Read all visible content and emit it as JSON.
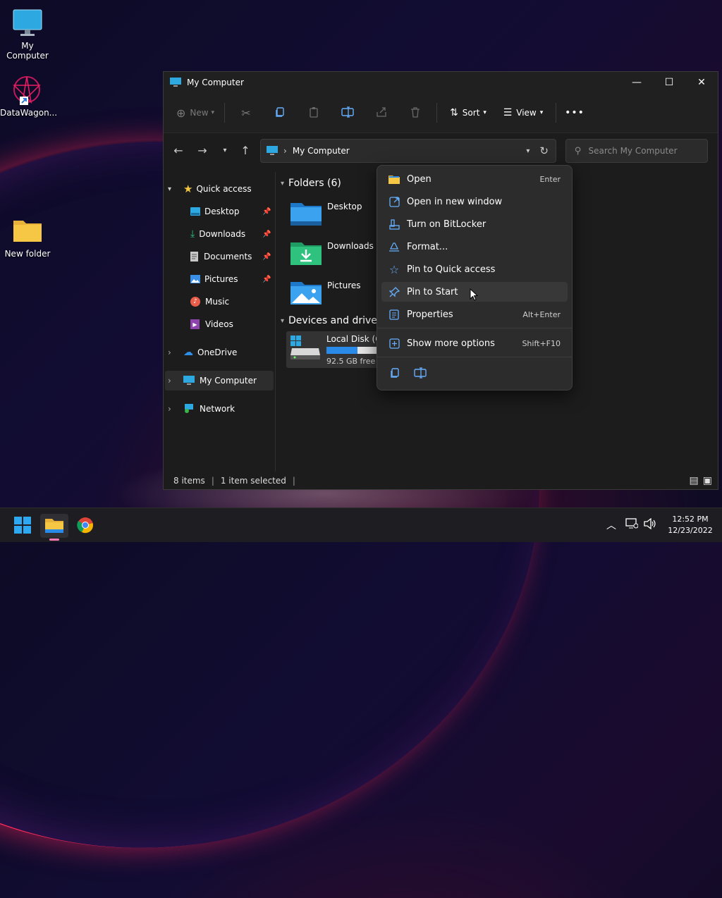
{
  "desktop": {
    "icons": [
      {
        "label": "My Computer",
        "icon": "monitor-icon"
      },
      {
        "label": "DataWagon...",
        "icon": "app-shortcut-icon"
      },
      {
        "label": "New folder",
        "icon": "folder-icon"
      }
    ]
  },
  "window": {
    "title": "My Computer",
    "controls": {
      "minimize": "—",
      "maximize": "☐",
      "close": "✕"
    }
  },
  "toolbar": {
    "new_label": "New",
    "sort_label": "Sort",
    "view_label": "View",
    "more_label": "•••"
  },
  "address": {
    "path": "My Computer"
  },
  "search": {
    "placeholder": "Search My Computer"
  },
  "sidebar": {
    "quick_access": "Quick access",
    "items": [
      {
        "label": "Desktop",
        "pinned": true
      },
      {
        "label": "Downloads",
        "pinned": true
      },
      {
        "label": "Documents",
        "pinned": true
      },
      {
        "label": "Pictures",
        "pinned": true
      },
      {
        "label": "Music",
        "pinned": false
      },
      {
        "label": "Videos",
        "pinned": false
      }
    ],
    "onedrive": "OneDrive",
    "mycomputer": "My Computer",
    "network": "Network"
  },
  "content": {
    "folders_header": "Folders (6)",
    "folders": [
      "Desktop",
      "Downloads",
      "Pictures"
    ],
    "devices_header": "Devices and drives",
    "drive_name": "Local Disk (C:",
    "drive_free": "92.5 GB free o",
    "drive_used_fraction": 0.55
  },
  "status": {
    "items": "8 items",
    "selected": "1 item selected"
  },
  "context_menu": {
    "items": [
      {
        "label": "Open",
        "shortcut": "Enter",
        "icon": "folder-open-icon"
      },
      {
        "label": "Open in new window",
        "shortcut": "",
        "icon": "new-window-icon"
      },
      {
        "label": "Turn on BitLocker",
        "shortcut": "",
        "icon": "key-icon"
      },
      {
        "label": "Format...",
        "shortcut": "",
        "icon": "format-icon"
      },
      {
        "label": "Pin to Quick access",
        "shortcut": "",
        "icon": "star-icon"
      },
      {
        "label": "Pin to Start",
        "shortcut": "",
        "icon": "pin-icon"
      },
      {
        "label": "Properties",
        "shortcut": "Alt+Enter",
        "icon": "properties-icon"
      },
      {
        "label": "Show more options",
        "shortcut": "Shift+F10",
        "icon": "more-options-icon"
      }
    ]
  },
  "taskbar": {
    "time": "12:52 PM",
    "date": "12/23/2022"
  },
  "colors": {
    "accent": "#0078d4",
    "menu_icon": "#66aefc",
    "folder_yellow": "#f6c745"
  }
}
